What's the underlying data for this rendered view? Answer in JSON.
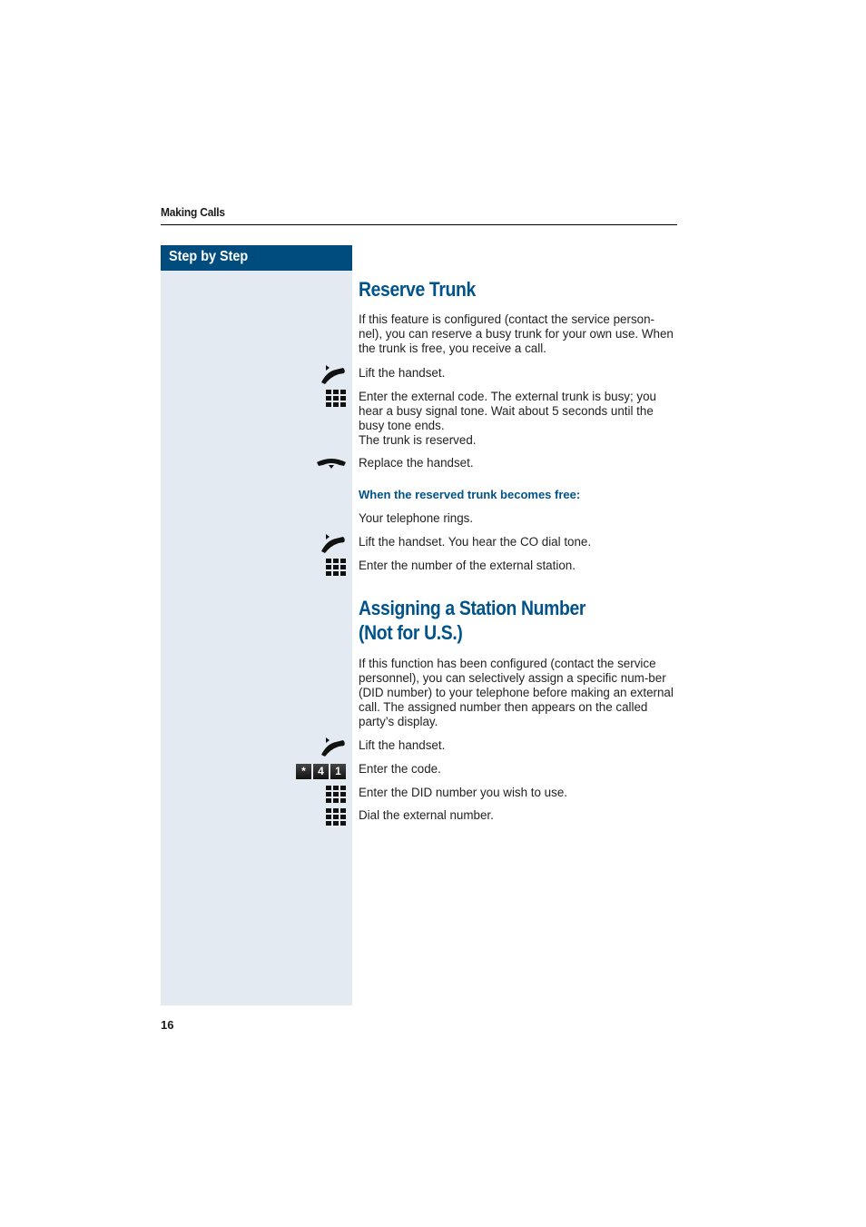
{
  "header": {
    "section": "Making Calls"
  },
  "sidebar": {
    "title": "Step by Step"
  },
  "sections": [
    {
      "title": "Reserve Trunk",
      "intro": "If this feature is configured (contact the service person-nel), you can reserve a busy trunk for your own use. When the trunk is free, you receive a call.",
      "steps": [
        {
          "icon": "handset-lift-icon",
          "text": "Lift the handset."
        },
        {
          "icon": "keypad-icon",
          "text": "Enter the external code. The external trunk is busy; you hear a busy signal tone. Wait about 5 seconds until the busy tone ends.",
          "text2": "The trunk is reserved."
        },
        {
          "icon": "handset-replace-icon",
          "text": "Replace the handset."
        }
      ],
      "subheading": "When the reserved trunk becomes free:",
      "steps2": [
        {
          "icon": "",
          "text": "Your telephone rings."
        },
        {
          "icon": "handset-lift-icon",
          "text": "Lift the handset. You hear the CO dial tone."
        },
        {
          "icon": "keypad-icon",
          "text": "Enter the number of the external station."
        }
      ]
    },
    {
      "title_line1": "Assigning a Station Number",
      "title_line2": "(Not for U.S.)",
      "intro": "If this function has been configured (contact the service personnel), you can selectively assign a specific num-ber (DID number) to your telephone before making an external call. The assigned number then appears on the called party’s display.",
      "steps": [
        {
          "icon": "handset-lift-icon",
          "text": "Lift the handset."
        },
        {
          "icon": "code-keys-icon",
          "keys": [
            "*",
            "4",
            "1"
          ],
          "text": "Enter the code."
        },
        {
          "icon": "keypad-icon",
          "text": "Enter the DID number you wish to use."
        },
        {
          "icon": "keypad-icon",
          "text": "Dial the external number."
        }
      ]
    }
  ],
  "footer": {
    "page_number": "16"
  },
  "colors": {
    "accent": "#004c7f",
    "heading": "#00538a",
    "sidebar_bg": "#e3eaf2"
  }
}
